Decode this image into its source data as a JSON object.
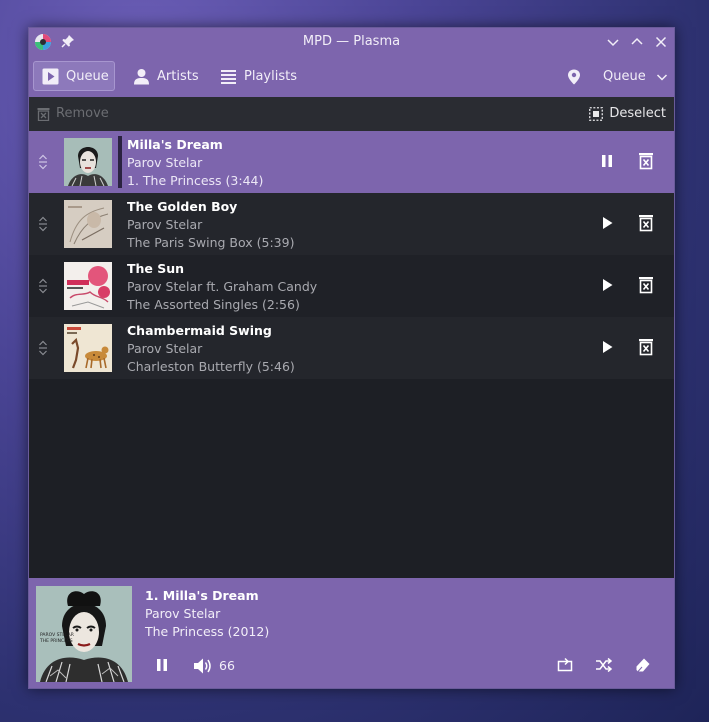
{
  "window": {
    "title": "MPD — Plasma"
  },
  "toolbar": {
    "tabs": [
      {
        "label": "Queue",
        "icon": "play-icon",
        "active": true
      },
      {
        "label": "Artists",
        "icon": "user-icon",
        "active": false
      },
      {
        "label": "Playlists",
        "icon": "list-icon",
        "active": false
      }
    ],
    "location_icon": "map-pin-icon",
    "view_select": "Queue"
  },
  "actions": {
    "remove_label": "Remove",
    "deselect_label": "Deselect"
  },
  "queue": [
    {
      "title": "Milla's Dream",
      "artist": "Parov Stelar",
      "detail": "1. The Princess (3:44)",
      "state": "playing"
    },
    {
      "title": "The Golden Boy",
      "artist": "Parov Stelar",
      "detail": "The Paris Swing Box (5:39)",
      "state": "stopped"
    },
    {
      "title": "The Sun",
      "artist": "Parov Stelar ft. Graham Candy",
      "detail": "The Assorted Singles (2:56)",
      "state": "stopped"
    },
    {
      "title": "Chambermaid Swing",
      "artist": "Parov Stelar",
      "detail": "Charleston Butterfly (5:46)",
      "state": "stopped"
    }
  ],
  "now_playing": {
    "title": "1. Milla's Dream",
    "artist": "Parov Stelar",
    "album": "The Princess (2012)",
    "volume": "66",
    "album_art_text": [
      "PAROV STELAR",
      "THE PRINCESS"
    ]
  },
  "colors": {
    "accent": "#7d65ad",
    "background": "#1d1f25",
    "actionbar": "#2a2c32"
  }
}
